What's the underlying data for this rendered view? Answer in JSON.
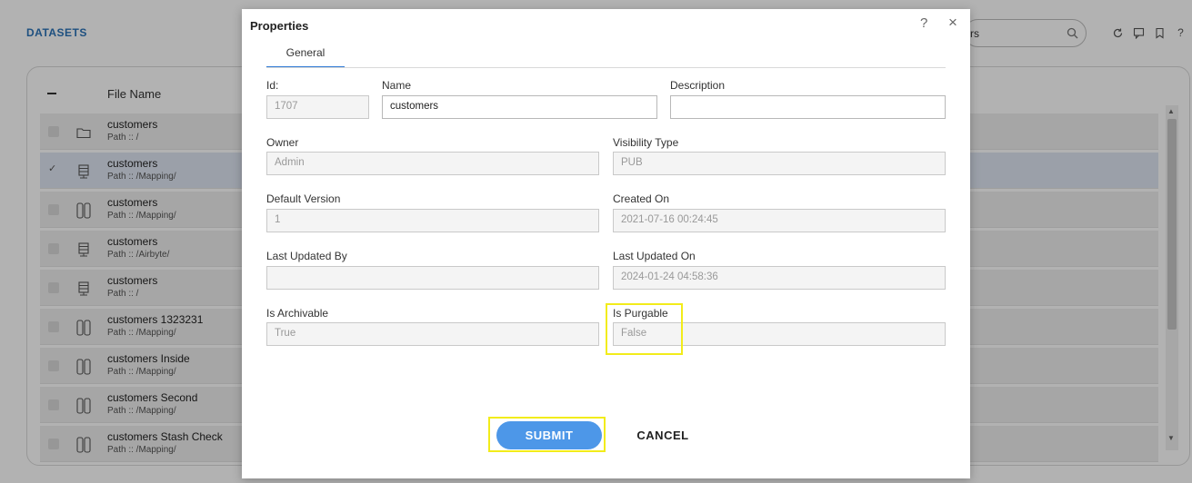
{
  "app": {
    "title": "DATASETS",
    "search_text": "rs",
    "list_header": {
      "file_name": "File Name"
    },
    "rows": [
      {
        "name": "customers",
        "path": "Path :: /",
        "icon": "folder-icon",
        "checked": false
      },
      {
        "name": "customers",
        "path": "Path :: /Mapping/",
        "icon": "server-icon",
        "checked": true
      },
      {
        "name": "customers",
        "path": "Path :: /Mapping/",
        "icon": "columns-icon",
        "checked": false
      },
      {
        "name": "customers",
        "path": "Path :: /Airbyte/",
        "icon": "server-icon",
        "checked": false
      },
      {
        "name": "customers",
        "path": "Path :: /",
        "icon": "server-icon",
        "checked": false
      },
      {
        "name": "customers 1323231",
        "path": "Path :: /Mapping/",
        "icon": "columns-icon",
        "checked": false
      },
      {
        "name": "customers Inside",
        "path": "Path :: /Mapping/",
        "icon": "columns-icon",
        "checked": false
      },
      {
        "name": "customers Second",
        "path": "Path :: /Mapping/",
        "icon": "columns-icon",
        "checked": false
      },
      {
        "name": "customers Stash Check",
        "path": "Path :: /Mapping/",
        "icon": "columns-icon",
        "checked": false
      }
    ]
  },
  "modal": {
    "title": "Properties",
    "help": "?",
    "close": "×",
    "tab_general": "General",
    "fields": {
      "id": {
        "label": "Id:",
        "value": "1707"
      },
      "name": {
        "label": "Name",
        "value": "customers"
      },
      "description": {
        "label": "Description",
        "value": ""
      },
      "owner": {
        "label": "Owner",
        "value": "Admin"
      },
      "visibility_type": {
        "label": "Visibility Type",
        "value": "PUB"
      },
      "default_version": {
        "label": "Default Version",
        "value": "1"
      },
      "created_on": {
        "label": "Created On",
        "value": "2021-07-16 00:24:45"
      },
      "last_updated_by": {
        "label": "Last Updated By",
        "value": ""
      },
      "last_updated_on": {
        "label": "Last Updated On",
        "value": "2024-01-24 04:58:36"
      },
      "is_archivable": {
        "label": "Is Archivable",
        "value": "True"
      },
      "is_purgable": {
        "label": "Is Purgable",
        "value": "False"
      }
    },
    "submit_label": "SUBMIT",
    "cancel_label": "CANCEL"
  },
  "colors": {
    "accent": "#2f7ad6",
    "submit": "#4d97e8",
    "highlight": "#f2ec1a",
    "title_blue": "#2b73b8"
  }
}
